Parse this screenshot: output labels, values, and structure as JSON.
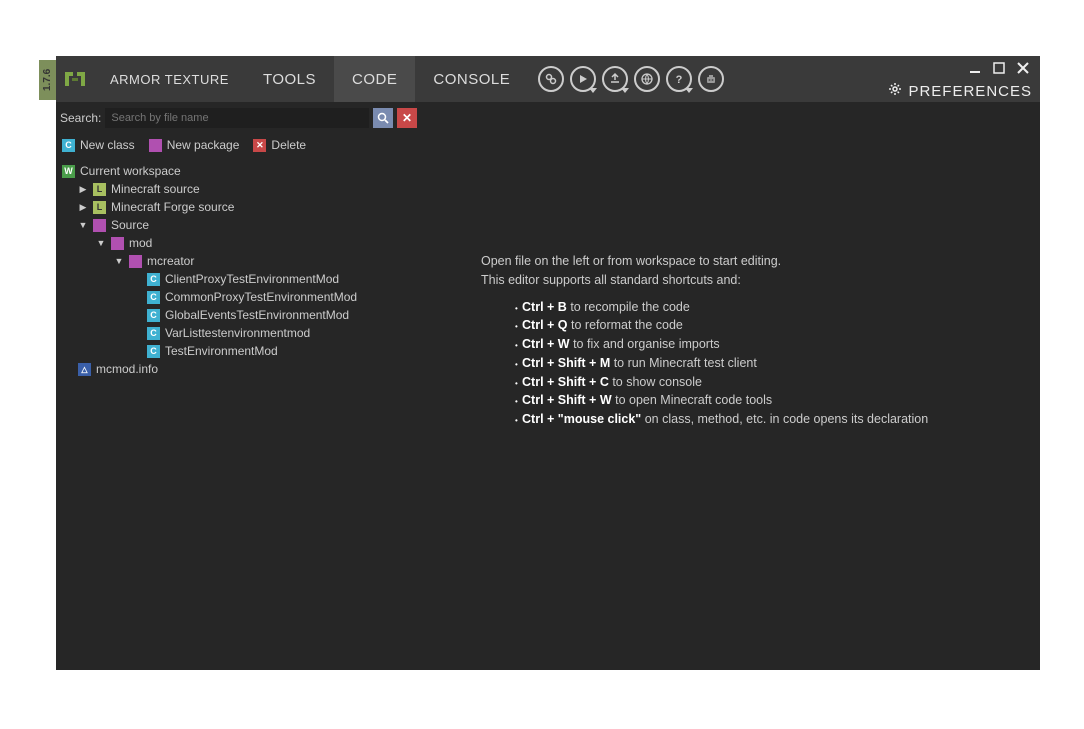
{
  "version": "1.7.6",
  "tabs": [
    "ARMOR TEXTURE",
    "TOOLS",
    "CODE",
    "CONSOLE"
  ],
  "activeTab": 2,
  "preferences": "PREFERENCES",
  "search": {
    "label": "Search:",
    "placeholder": "Search by file name"
  },
  "actions": {
    "newClass": "New class",
    "newPackage": "New package",
    "delete": "Delete"
  },
  "tree": {
    "root": "Current workspace",
    "n1": "Minecraft source",
    "n2": "Minecraft Forge source",
    "n3": "Source",
    "n4": "mod",
    "n5": "mcreator",
    "f1": "ClientProxyTestEnvironmentMod",
    "f2": "CommonProxyTestEnvironmentMod",
    "f3": "GlobalEventsTestEnvironmentMod",
    "f4": "VarListtestenvironmentmod",
    "f5": "TestEnvironmentMod",
    "f6": "mcmod.info"
  },
  "editor": {
    "line1": "Open file on the left or from workspace to start editing.",
    "line2": "This editor supports all standard shortcuts and:",
    "sc": [
      {
        "k": "Ctrl + B",
        "d": " to recompile the code"
      },
      {
        "k": "Ctrl + Q",
        "d": " to reformat the code"
      },
      {
        "k": "Ctrl + W",
        "d": " to fix and organise imports"
      },
      {
        "k": "Ctrl + Shift + M",
        "d": " to run Minecraft test client"
      },
      {
        "k": "Ctrl + Shift + C",
        "d": " to show console"
      },
      {
        "k": "Ctrl + Shift + W",
        "d": " to open Minecraft code tools"
      },
      {
        "k": "Ctrl + \"mouse click\"",
        "d": " on class, method, etc. in code opens its declaration"
      }
    ]
  }
}
